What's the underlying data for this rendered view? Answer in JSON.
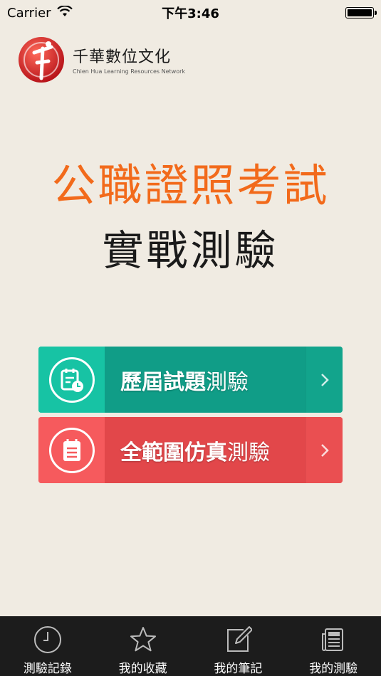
{
  "status_bar": {
    "carrier": "Carrier",
    "time": "下午3:46"
  },
  "logo": {
    "name": "千華數位文化",
    "subtitle": "Chien Hua Learning Resources Network"
  },
  "headline": {
    "line1": "公職證照考試",
    "line2": "實戰測驗"
  },
  "cards": [
    {
      "bold": "歷屆試題",
      "light": "測驗",
      "icon": "calendar-clock-icon",
      "color": "#17c3a4"
    },
    {
      "bold": "全範圍仿真",
      "light": "測驗",
      "icon": "notepad-icon",
      "color": "#f65a5d"
    }
  ],
  "tabs": [
    {
      "label": "測驗記錄",
      "icon": "clock-icon"
    },
    {
      "label": "我的收藏",
      "icon": "star-icon"
    },
    {
      "label": "我的筆記",
      "icon": "pencil-note-icon"
    },
    {
      "label": "我的測驗",
      "icon": "newspaper-icon"
    }
  ]
}
